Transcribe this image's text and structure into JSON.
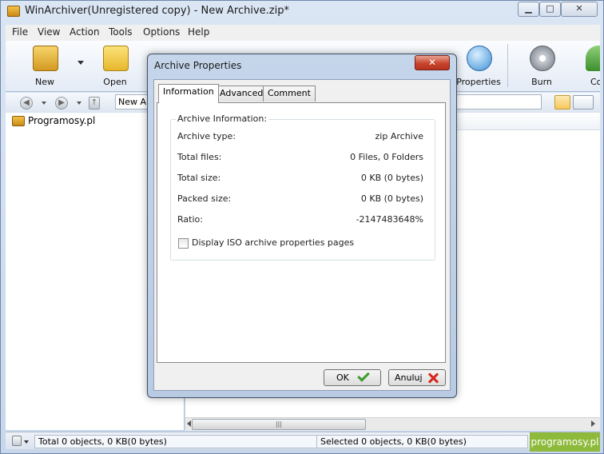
{
  "window": {
    "title": "WinArchiver(Unregistered copy) - New Archive.zip*",
    "controls": {
      "minimize": "▁",
      "maximize": "□",
      "close": "✕"
    }
  },
  "menu": [
    "File",
    "View",
    "Action",
    "Tools",
    "Options",
    "Help"
  ],
  "toolbar": {
    "new_label": "New",
    "open_label": "Open",
    "properties_label": "Properties",
    "burn_label": "Burn",
    "partial_label": "Co"
  },
  "address": {
    "value": "New Ar"
  },
  "tree": {
    "root": "Programosy.pl"
  },
  "status": {
    "left": "Total 0 objects, 0 KB(0 bytes)",
    "right": "Selected 0 objects, 0 KB(0 bytes)"
  },
  "watermark": "programosy.pl",
  "scroll_grip": "|||",
  "dialog": {
    "title": "Archive Properties",
    "close_glyph": "✕",
    "tabs": [
      "Information",
      "Advanced",
      "Comment"
    ],
    "active_tab": "Information",
    "group_title": "Archive Information:",
    "rows": [
      {
        "label": "Archive type:",
        "value": "zip Archive"
      },
      {
        "label": "Total files:",
        "value": "0 Files, 0 Folders"
      },
      {
        "label": "Total size:",
        "value": "0 KB (0 bytes)"
      },
      {
        "label": "Packed size:",
        "value": "0 KB (0 bytes)"
      },
      {
        "label": "Ratio:",
        "value": "-2147483648%"
      }
    ],
    "checkbox_label": "Display ISO archive properties pages",
    "checkbox_checked": false,
    "ok_label": "OK",
    "cancel_label": "Anuluj"
  },
  "colors": {
    "accent": "#3f9a2e",
    "cancel": "#d8241c",
    "watermark": "#8dba3a"
  }
}
